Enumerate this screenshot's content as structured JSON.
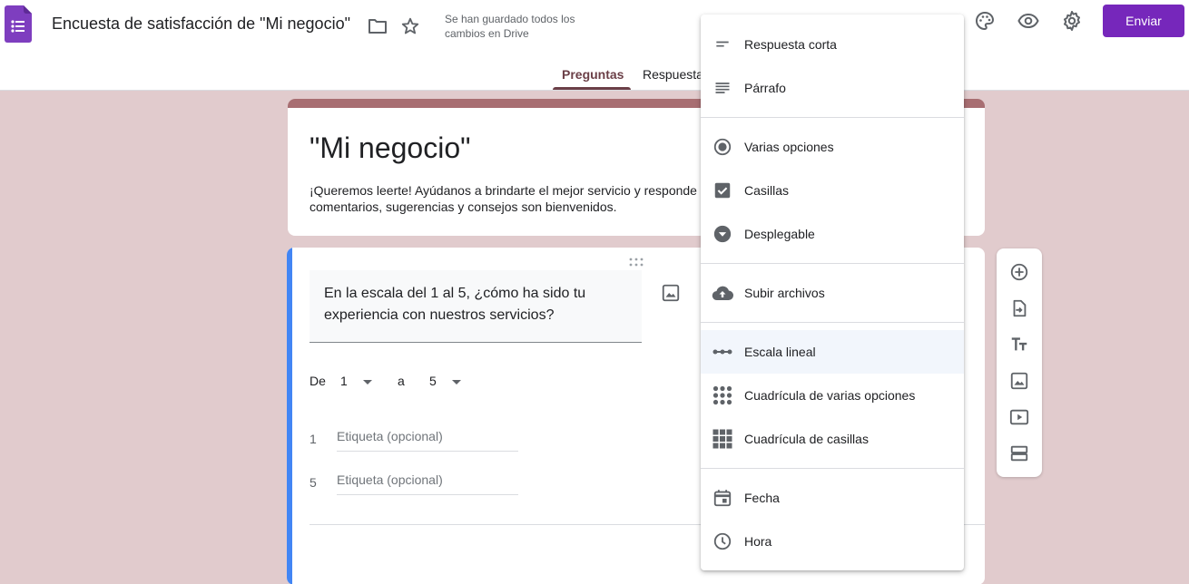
{
  "header": {
    "doc_title": "Encuesta de satisfacción de \"Mi negocio\"",
    "save_status_line1": "Se han guardado todos los",
    "save_status_line2": "cambios en Drive",
    "send_label": "Enviar",
    "icons": [
      "forms-logo-icon",
      "folder-icon",
      "star-icon",
      "palette-icon",
      "eye-icon",
      "gear-icon"
    ]
  },
  "tabs": [
    {
      "label": "Preguntas",
      "active": true
    },
    {
      "label": "Respuesta",
      "active": false
    }
  ],
  "form": {
    "title": "\"Mi negocio\"",
    "description_line1": "¡Queremos leerte! Ayúdanos a brindarte el mejor servicio y responde",
    "description_line2": "comentarios, sugerencias y consejos son bienvenidos."
  },
  "question": {
    "text": "En la escala del 1 al 5, ¿cómo ha sido tu experiencia con nuestros servicios?",
    "range_from_label": "De",
    "range_from_value": "1",
    "range_to_label": "a",
    "range_to_value": "5",
    "low_number": "1",
    "low_placeholder": "Etiqueta (opcional)",
    "high_number": "5",
    "high_placeholder": "Etiqueta (opcional)"
  },
  "menu": {
    "items": [
      {
        "label": "Respuesta corta",
        "icon": "short-answer-icon"
      },
      {
        "label": "Párrafo",
        "icon": "paragraph-icon"
      },
      {
        "label": "Varias opciones",
        "icon": "radio-icon"
      },
      {
        "label": "Casillas",
        "icon": "checkbox-icon"
      },
      {
        "label": "Desplegable",
        "icon": "dropdown-icon"
      },
      {
        "label": "Subir archivos",
        "icon": "cloud-upload-icon"
      },
      {
        "label": "Escala lineal",
        "icon": "linear-scale-icon",
        "selected": true
      },
      {
        "label": "Cuadrícula de varias opciones",
        "icon": "radio-grid-icon"
      },
      {
        "label": "Cuadrícula de casillas",
        "icon": "checkbox-grid-icon"
      },
      {
        "label": "Fecha",
        "icon": "calendar-icon"
      },
      {
        "label": "Hora",
        "icon": "clock-icon"
      }
    ]
  },
  "side_toolbar": [
    "add-question-icon",
    "import-questions-icon",
    "add-title-icon",
    "add-image-icon",
    "add-video-icon",
    "add-section-icon"
  ],
  "colors": {
    "accent": "#7627bb",
    "theme": "#a86e72",
    "background": "#e1cbcd",
    "question_bar": "#4285f4"
  }
}
